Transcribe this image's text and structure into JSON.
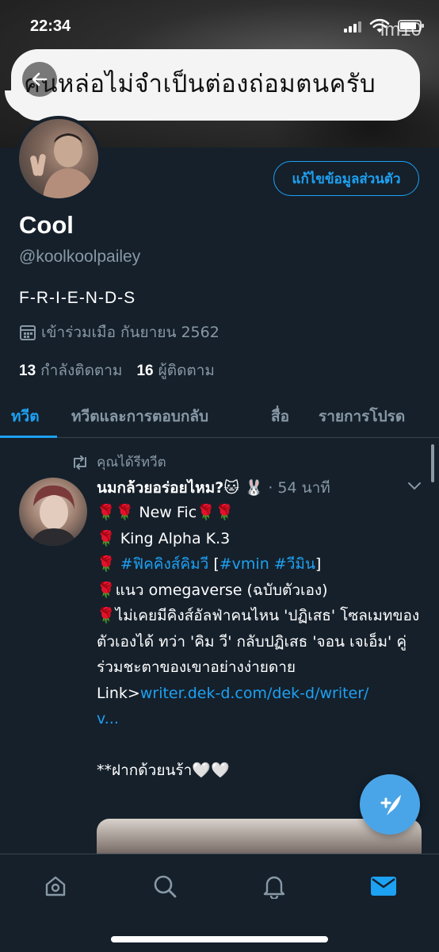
{
  "status_bar": {
    "time": "22:34"
  },
  "banner": {
    "caption": "คนหล่อไม่จำเป็นต่องถ่อมตนครับ",
    "watermark": "im10"
  },
  "profile": {
    "edit_label": "แก้ไขข้อมูลส่วนตัว",
    "display_name": "Cool",
    "handle": "@koolkoolpailey",
    "bio": "F-R-I-E-N-D-S",
    "joined": "เข้าร่วมเมือ กันยายน 2562",
    "following_count": "13",
    "following_label": "กำลังติดตาม",
    "followers_count": "16",
    "followers_label": "ผู้ติดตาม"
  },
  "tabs": [
    {
      "label": "ทวีต",
      "active": true
    },
    {
      "label": "ทวีตและการตอบกลับ",
      "active": false
    },
    {
      "label": "สื่อ",
      "active": false
    },
    {
      "label": "รายการโปรด",
      "active": false
    }
  ],
  "tweet": {
    "retweet_label": "คุณได้รีทวีต",
    "author": "นมกล้วยอร่อยไหม?🐱 🐰",
    "time": "· 54 นาที",
    "rose": "🌹",
    "line1_text": " New Fic",
    "line2_text": " King Alpha K.3",
    "line3_hashtag": "#ฟิคคิงส์คิมวี",
    "line3_bracket_open": " [",
    "line3_tags": "#vmin #วีมิน",
    "line3_bracket_close": "]",
    "line4_text": "แนว omegaverse (ฉบับตัวเอง)",
    "line5_text": "ไม่เคยมีคิงส์อัลฟ่าคนไหน 'ปฏิเสธ' โซลเมทของตัวเองได้ ทว่า 'คิม วี' กลับปฏิเสธ 'จอน เจเอ็ม' คู่ร่วมชะตาของเขาอย่างง่ายดาย",
    "link_prefix": "Link>",
    "link_text": "writer.dek-d.com/dek-d/writer/",
    "link_cont": "v...",
    "closing": "**ฝากด้วยนร้า🤍🤍"
  },
  "colors": {
    "accent": "#1da1f2",
    "background": "#15202b",
    "muted": "#8899a6",
    "fab": "#4aa5e8"
  },
  "icons": {
    "back": "arrow-left-icon",
    "calendar": "calendar-icon",
    "retweet": "retweet-icon",
    "caret": "chevron-down-icon",
    "compose": "feather-plus-icon",
    "nav": [
      "home-icon",
      "search-icon",
      "bell-icon",
      "mail-icon"
    ]
  }
}
